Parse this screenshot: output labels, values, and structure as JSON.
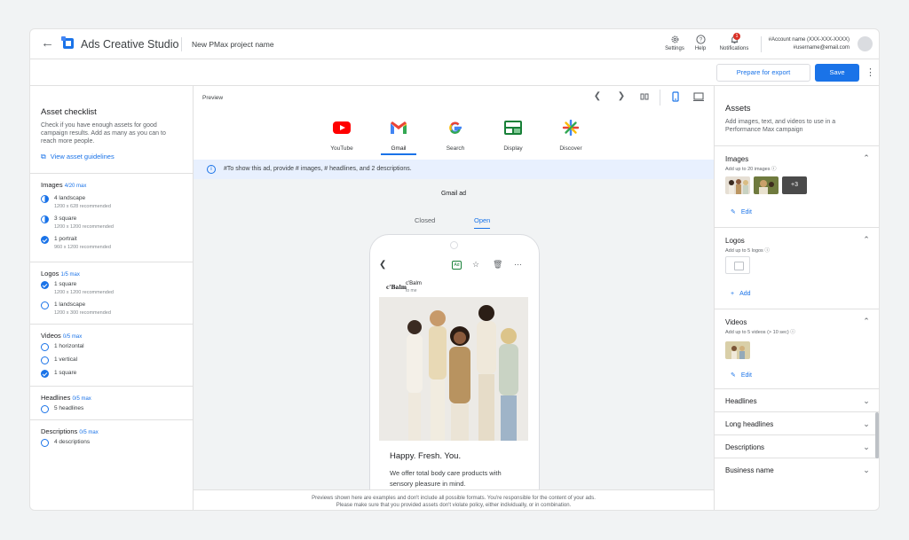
{
  "header": {
    "app_name": "Ads Creative Studio",
    "project_name": "New PMax project name",
    "settings_label": "Settings",
    "help_label": "Help",
    "notifications_label": "Notifications",
    "notifications_count": "1",
    "account_name": "#Account name (XXX-XXX-XXXX)",
    "account_email": "#username@email.com"
  },
  "actions": {
    "export_label": "Prepare for export",
    "save_label": "Save"
  },
  "checklist": {
    "title": "Asset checklist",
    "description": "Check if you have enough assets for good campaign results. Add as many as you can to reach more people.",
    "guidelines_link": "View asset guidelines",
    "images": {
      "title": "Images",
      "count": "4/20 max",
      "items": [
        {
          "label": "4 landscape",
          "sub": "1200 x 628 recommended",
          "state": "half"
        },
        {
          "label": "3 square",
          "sub": "1200 x 1200 recommended",
          "state": "half"
        },
        {
          "label": "1 portrait",
          "sub": "960 x 1200 recommended",
          "state": "full"
        }
      ]
    },
    "logos": {
      "title": "Logos",
      "count": "1/5 max",
      "items": [
        {
          "label": "1 square",
          "sub": "1200 x 1200 recommended",
          "state": "full"
        },
        {
          "label": "1 landscape",
          "sub": "1200 x 300 recommended",
          "state": "empty"
        }
      ]
    },
    "videos": {
      "title": "Videos",
      "count": "0/5 max",
      "items": [
        {
          "label": "1 horizontal",
          "state": "empty"
        },
        {
          "label": "1 vertical",
          "state": "empty"
        },
        {
          "label": "1 square",
          "state": "full"
        }
      ]
    },
    "headlines": {
      "title": "Headlines",
      "count": "0/5 max",
      "items": [
        {
          "label": "5 headlines",
          "state": "empty"
        }
      ]
    },
    "descriptions": {
      "title": "Descriptions",
      "count": "0/5 max",
      "items": [
        {
          "label": "4 descriptions",
          "state": "empty"
        }
      ]
    }
  },
  "preview": {
    "label": "Preview",
    "formats": [
      {
        "label": "YouTube",
        "icon": "youtube-icon"
      },
      {
        "label": "Gmail",
        "icon": "gmail-icon"
      },
      {
        "label": "Search",
        "icon": "google-search-icon"
      },
      {
        "label": "Display",
        "icon": "display-icon"
      },
      {
        "label": "Discover",
        "icon": "discover-icon"
      }
    ],
    "active_format": "Gmail",
    "info_text": "#To show this ad, provide # images, # headlines, and 2 descriptions.",
    "ad_type_label": "Gmail ad",
    "toggle_closed": "Closed",
    "toggle_open": "Open",
    "email": {
      "brand_logo": "c'Balm",
      "sender": "c'Balm",
      "to": "to me",
      "ad_badge": "Ad",
      "headline": "Happy. Fresh. You.",
      "body": "We offer total body care products with sensory pleasure in mind."
    },
    "disclaimer_line1": "Previews shown here are examples and don't include all possible formats. You're responsible for the content of your ads.",
    "disclaimer_line2": "Please make sure that you provided assets don't violate policy, either individually, or in combination."
  },
  "assets": {
    "title": "Assets",
    "description": "Add images, text, and videos to use in a Performance Max campaign",
    "images": {
      "title": "Images",
      "sub": "Add up to 20 images",
      "more_count": "+3",
      "edit_label": "Edit"
    },
    "logos": {
      "title": "Logos",
      "sub": "Add up to 5 logos",
      "add_label": "Add"
    },
    "videos": {
      "title": "Videos",
      "sub": "Add up to 5 videos (> 10 sec)",
      "edit_label": "Edit"
    },
    "collapsed": [
      "Headlines",
      "Long headlines",
      "Descriptions",
      "Business name"
    ]
  },
  "colors": {
    "accent": "#1a73e8",
    "info_bg": "#e8f0fe"
  }
}
